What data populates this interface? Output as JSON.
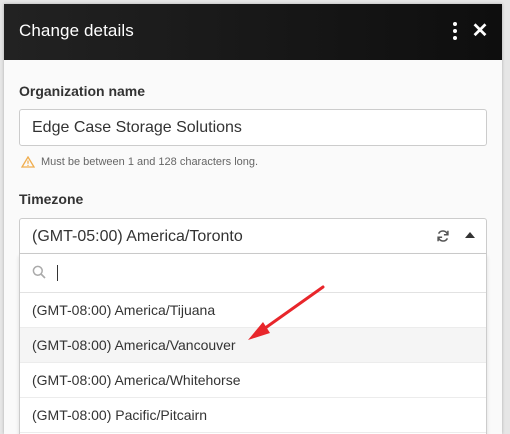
{
  "dialog": {
    "title": "Change details"
  },
  "form": {
    "org_label": "Organization name",
    "org_value": "Edge Case Storage Solutions",
    "org_hint": "Must be between 1 and 128 characters long.",
    "tz_label": "Timezone",
    "tz_value": "(GMT-05:00) America/Toronto"
  },
  "dropdown": {
    "search_value": "",
    "options": [
      "(GMT-08:00) America/Tijuana",
      "(GMT-08:00) America/Vancouver",
      "(GMT-08:00) America/Whitehorse",
      "(GMT-08:00) Pacific/Pitcairn"
    ]
  },
  "colors": {
    "annotation_arrow": "#e8262b",
    "warning": "#f0ad4e"
  },
  "icons": {
    "menu": "kebab-icon",
    "close": "close-icon",
    "warning": "warning-icon",
    "refresh": "refresh-icon",
    "collapse": "caret-up-icon",
    "search": "search-icon"
  }
}
